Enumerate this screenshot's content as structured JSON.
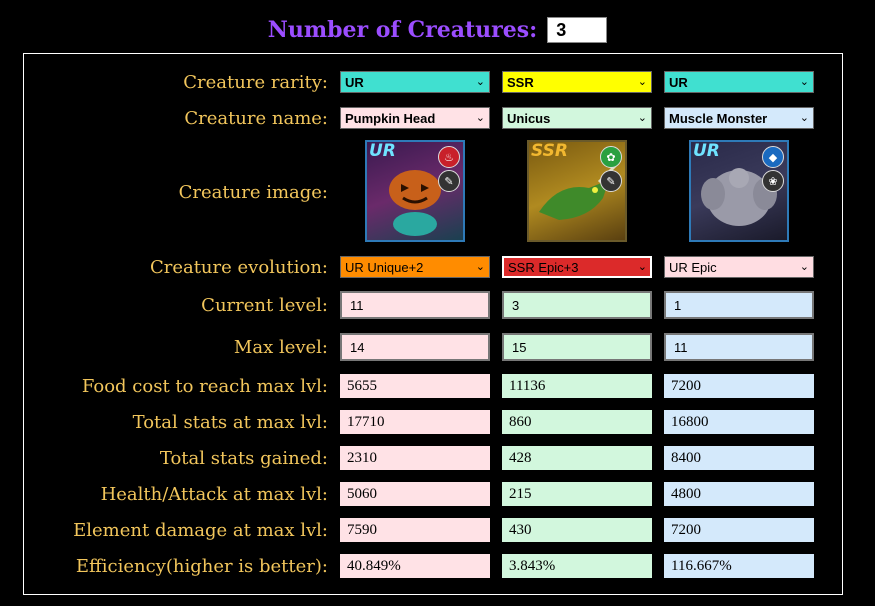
{
  "header": {
    "title": "Number of Creatures:",
    "count": "3"
  },
  "labels": {
    "rarity": "Creature rarity:",
    "name": "Creature name:",
    "image": "Creature image:",
    "evolution": "Creature evolution:",
    "current_level": "Current level:",
    "max_level": "Max level:",
    "food_cost": "Food cost to reach max lvl:",
    "total_stats": "Total stats at max lvl:",
    "stats_gained": "Total stats gained:",
    "health_attack": "Health/Attack at max lvl:",
    "element_damage": "Element damage at max lvl:",
    "efficiency": "Efficiency(higher is better):"
  },
  "creatures": [
    {
      "rarity": "UR",
      "rarity_color": "#40e0d0",
      "name": "Pumpkin Head",
      "image_badge": "UR",
      "element_icon": "fire-icon",
      "class_icon": "feather-icon",
      "evolution": "UR Unique+2",
      "evolution_color": "#ff8c00",
      "current_level": "11",
      "max_level": "14",
      "food_cost": "5655",
      "total_stats": "17710",
      "stats_gained": "2310",
      "health_attack": "5060",
      "element_damage": "7590",
      "efficiency": "40.849%"
    },
    {
      "rarity": "SSR",
      "rarity_color": "#ffff00",
      "name": "Unicus",
      "image_badge": "SSR",
      "element_icon": "leaf-icon",
      "class_icon": "feather-icon",
      "evolution": "SSR Epic+3",
      "evolution_color": "#dc2a2a",
      "current_level": "3",
      "max_level": "15",
      "food_cost": "11136",
      "total_stats": "860",
      "stats_gained": "428",
      "health_attack": "215",
      "element_damage": "430",
      "efficiency": "3.843%"
    },
    {
      "rarity": "UR",
      "rarity_color": "#40e0d0",
      "name": "Muscle Monster",
      "image_badge": "UR",
      "element_icon": "water-icon",
      "class_icon": "paw-icon",
      "evolution": "UR Epic",
      "evolution_color": "#ffdde2",
      "current_level": "1",
      "max_level": "11",
      "food_cost": "7200",
      "total_stats": "16800",
      "stats_gained": "8400",
      "health_attack": "4800",
      "element_damage": "7200",
      "efficiency": "116.667%"
    }
  ]
}
